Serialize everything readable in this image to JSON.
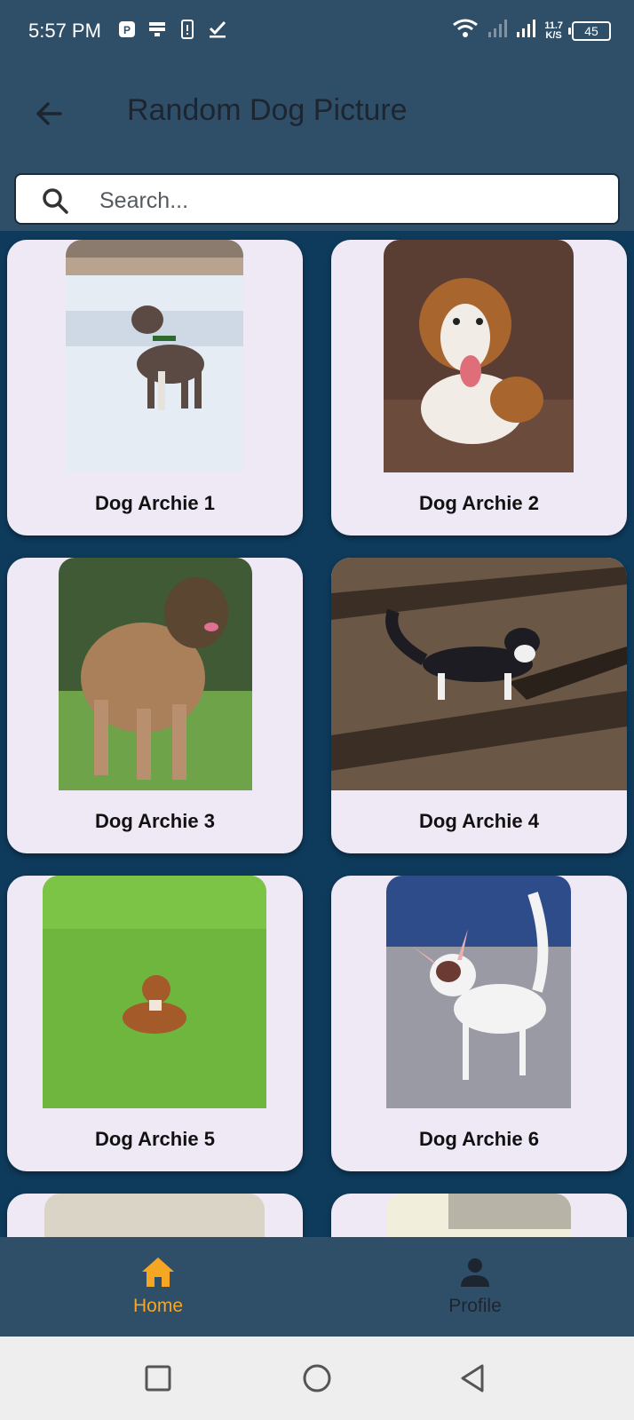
{
  "status_bar": {
    "time": "5:57 PM",
    "speed_top": "11.7",
    "speed_bottom": "K/S",
    "battery": "45"
  },
  "app_bar": {
    "title": "Random Dog Picture",
    "back_icon": "arrow-left-icon"
  },
  "search": {
    "placeholder": "Search...",
    "icon": "search-icon"
  },
  "cards": [
    {
      "label": "Dog Archie 1"
    },
    {
      "label": "Dog Archie 2"
    },
    {
      "label": "Dog Archie 3"
    },
    {
      "label": "Dog Archie 4"
    },
    {
      "label": "Dog Archie 5"
    },
    {
      "label": "Dog Archie 6"
    }
  ],
  "bottom_nav": {
    "items": [
      {
        "label": "Home",
        "icon": "home-icon",
        "active": true
      },
      {
        "label": "Profile",
        "icon": "person-icon",
        "active": false
      }
    ]
  },
  "colors": {
    "app_bar": "#2f4f69",
    "background": "#0e3a5b",
    "card": "#efe9f5",
    "active_nav": "#f5a623"
  }
}
